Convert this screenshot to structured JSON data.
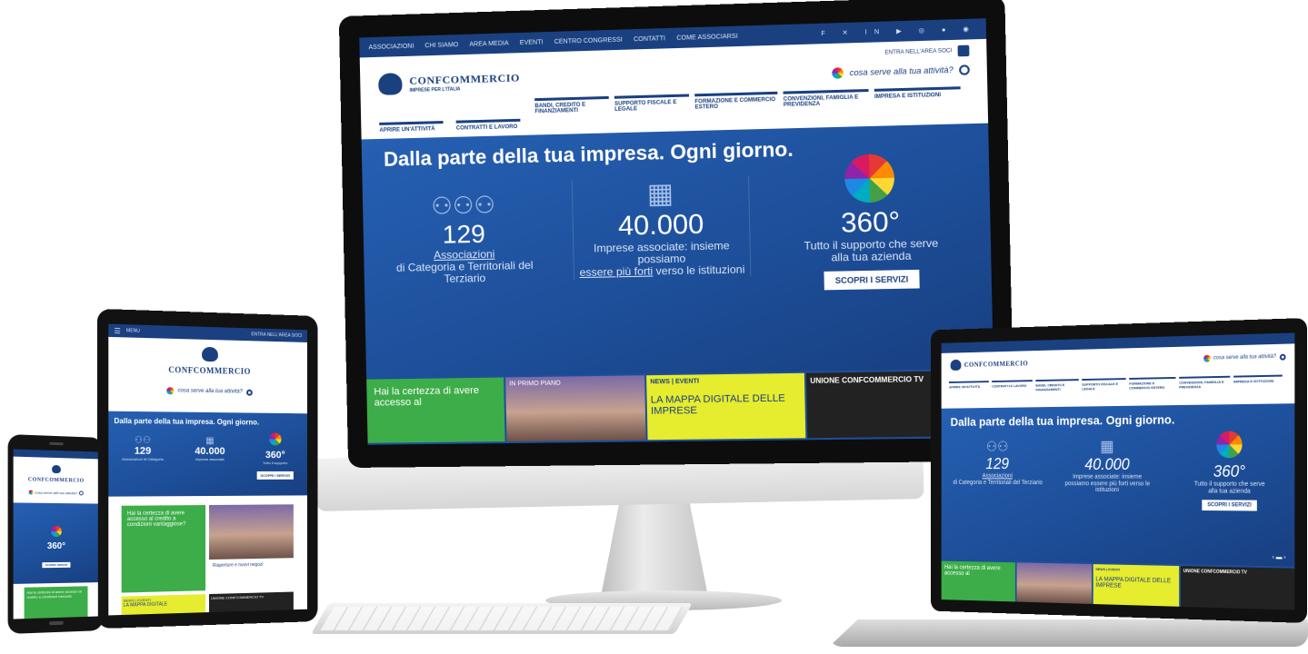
{
  "desktop": {
    "topnav": [
      "ASSOCIAZIONI",
      "CHI SIAMO",
      "AREA MEDIA",
      "EVENTI",
      "CENTRO CONGRESSI",
      "CONTATTI",
      "COME ASSOCIARSI"
    ],
    "social_icons": [
      "facebook-icon",
      "twitter-icon",
      "linkedin-icon",
      "youtube-icon",
      "instagram-icon",
      "flickr-icon",
      "rss-icon"
    ],
    "reserved_area": "ENTRA NELL'AREA SOCI",
    "logo_title": "CONFCOMMERCIO",
    "logo_subtitle": "IMPRESE PER L'ITALIA",
    "search_placeholder": "cosa serve alla tua attività?",
    "nav_top": [
      "BANDI, CREDITO E FINANZIAMENTI",
      "SUPPORTO FISCALE E LEGALE",
      "FORMAZIONE E COMMERCIO ESTERO",
      "CONVENZIONI, FAMIGLIA E PREVIDENZA",
      "IMPRESA E ISTITUZIONI"
    ],
    "nav_bottom": [
      "APRIRE UN'ATTIVITÀ",
      "CONTRATTI E LAVORO"
    ],
    "hero_title": "Dalla parte della tua impresa. Ogni giorno.",
    "stats": [
      {
        "icon": "people-icon",
        "number": "129",
        "link": "Associazioni",
        "text": "di Categoria e Territoriali del Terziario"
      },
      {
        "icon": "buildings-icon",
        "number": "40.000",
        "text": "Imprese associate: insieme possiamo",
        "link": "essere più forti",
        "text2": "verso le istituzioni"
      },
      {
        "icon": "flower-icon",
        "number": "360°",
        "text": "Tutto il supporto che serve alla tua azienda",
        "button": "SCOPRI I SERVIZI"
      }
    ],
    "tiles": {
      "green": "Hai la certezza di avere accesso al",
      "photo": "IN PRIMO PIANO",
      "yellow_tag": "NEWS | EVENTI",
      "yellow_text": "LA MAPPA DIGITALE DELLE IMPRESE",
      "dark": "UNIONE CONFCOMMERCIO TV"
    }
  },
  "tablet": {
    "menu": "MENU",
    "reserved": "ENTRA NELL'AREA SOCI",
    "logo_title": "CONFCOMMERCIO",
    "search_placeholder": "cosa serve alla tua attività?",
    "hero_title": "Dalla parte della tua impresa. Ogni giorno.",
    "stats": [
      "129",
      "40.000",
      "360°"
    ],
    "stat_captions": [
      "Associazioni di Categoria",
      "Imprese associate",
      "Tutto il supporto"
    ],
    "button": "SCOPRI I SERVIZI",
    "green_tile": "Hai la certezza di avere accesso al credito a condizioni vantaggiose?",
    "photo_caption": "Riaperture e nuovi negozi",
    "yellow_tag": "NEWS | EVENTI",
    "yellow_text": "LA MAPPA DIGITALE",
    "dark_tile": "UNIONE CONFCOMMERCIO TV"
  },
  "phone": {
    "logo_title": "CONFCOMMERCIO",
    "search_placeholder": "cosa serve alla tua attività?",
    "stat": "360°",
    "button": "SCOPRI I SERVIZI",
    "green_tile": "Hai la certezza di avere accesso al credito a condizioni bancarie"
  },
  "laptop": {
    "logo_title": "CONFCOMMERCIO",
    "search_placeholder": "cosa serve alla tua attività?",
    "nav": [
      "APRIRE UN'ATTIVITÀ",
      "CONTRATTI E LAVORO",
      "BANDI, CREDITO E FINANZIAMENTI",
      "SUPPORTO FISCALE E LEGALE",
      "FORMAZIONE E COMMERCIO ESTERO",
      "CONVENZIONI, FAMIGLIA E PREVIDENZA",
      "IMPRESA E ISTITUZIONI"
    ],
    "hero_title": "Dalla parte della tua impresa. Ogni giorno.",
    "stats": [
      {
        "number": "129",
        "link": "Associazioni",
        "text": "di Categoria e Territoriali del Terziario"
      },
      {
        "number": "40.000",
        "text": "Imprese associate: insieme possiamo essere più forti verso le istituzioni"
      },
      {
        "number": "360°",
        "text": "Tutto il supporto che serve alla tua azienda",
        "button": "SCOPRI I SERVIZI"
      }
    ],
    "tiles": {
      "green": "Hai la certezza di avere accesso al",
      "yellow_tag": "NEWS | EVENTI",
      "yellow_text": "LA MAPPA DIGITALE DELLE IMPRESE",
      "dark": "UNIONE CONFCOMMERCIO TV"
    }
  }
}
